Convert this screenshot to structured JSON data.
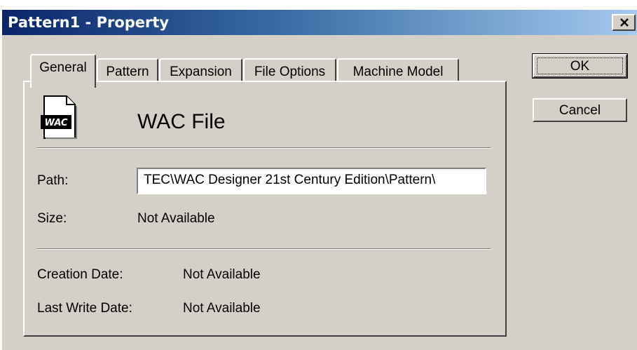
{
  "window": {
    "title": "Pattern1 - Property"
  },
  "tabs": [
    {
      "label": "General",
      "active": true
    },
    {
      "label": "Pattern",
      "active": false
    },
    {
      "label": "Expansion",
      "active": false
    },
    {
      "label": "File Options",
      "active": false
    },
    {
      "label": "Machine Model",
      "active": false
    }
  ],
  "buttons": {
    "ok": "OK",
    "cancel": "Cancel"
  },
  "general": {
    "icon_text": "WAC",
    "heading": "WAC File",
    "path_label": "Path:",
    "path_value": "TEC\\WAC Designer 21st Century Edition\\Pattern\\",
    "size_label": "Size:",
    "size_value": "Not Available",
    "creation_label": "Creation Date:",
    "creation_value": "Not Available",
    "lastwrite_label": "Last Write Date:",
    "lastwrite_value": "Not Available"
  },
  "icons": {
    "file": "document-icon",
    "close": "close-icon"
  }
}
